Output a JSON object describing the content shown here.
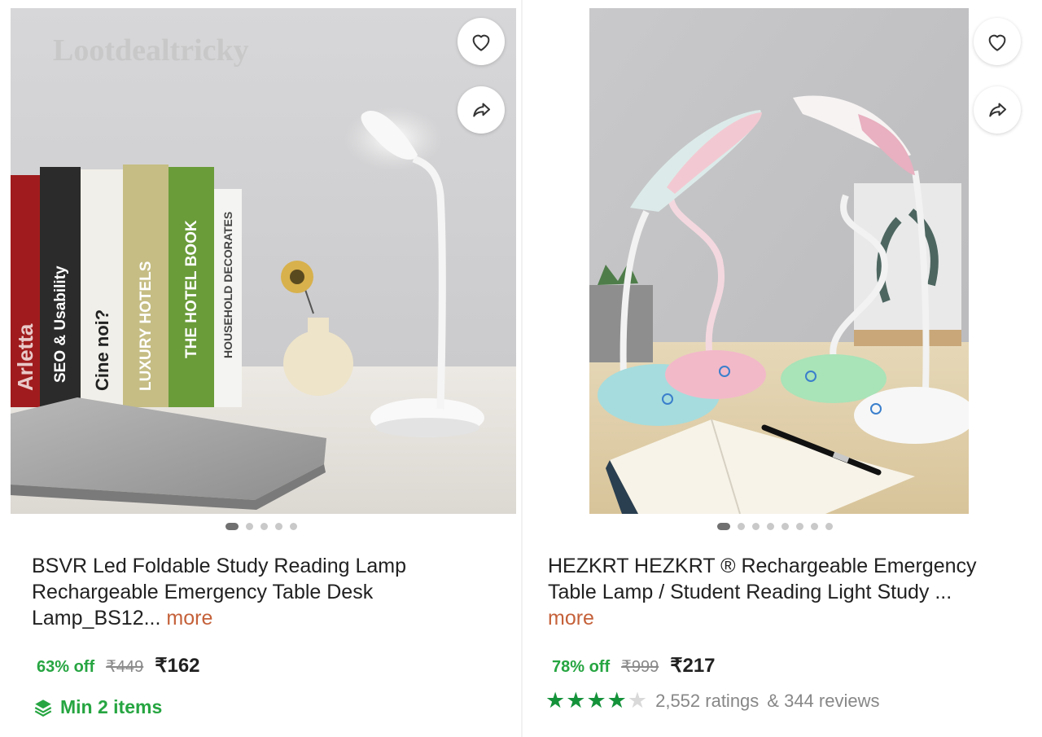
{
  "products": [
    {
      "watermark": "Lootdealtricky",
      "image_alt": "Desk lamp with books",
      "title_text": "BSVR Led Foldable Study Reading Lamp Rechargeable Emergency Table Desk Lamp_BS12...",
      "more_label": "more",
      "discount": "63% off",
      "mrp": "₹449",
      "price": "₹162",
      "min_items": "Min 2 items",
      "carousel_count": 5,
      "carousel_active": 1,
      "book_spines": [
        "Arletta",
        "SEO & Usability",
        "Cine noi?",
        "LUXURY HOTELS",
        "THE HOTEL BOOK",
        "HOUSEHOLD DECORATES"
      ]
    },
    {
      "title_text": "HEZKRT HEZKRT ® Rechargeable Emergency Table Lamp / Student Reading Light Study ...",
      "more_label": "more",
      "discount": "78% off",
      "mrp": "₹999",
      "price": "₹217",
      "rating": 4,
      "ratings_text": "2,552 ratings",
      "reviews_text": "& 344 reviews",
      "carousel_count": 8,
      "carousel_active": 1
    }
  ],
  "icons": {
    "wishlist": "heart-icon",
    "share": "share-icon",
    "min_items": "layers-icon",
    "star": "star-icon"
  },
  "colors": {
    "discount_green": "#26a541",
    "rating_green": "#14923a",
    "more_orange": "#c5613a"
  }
}
